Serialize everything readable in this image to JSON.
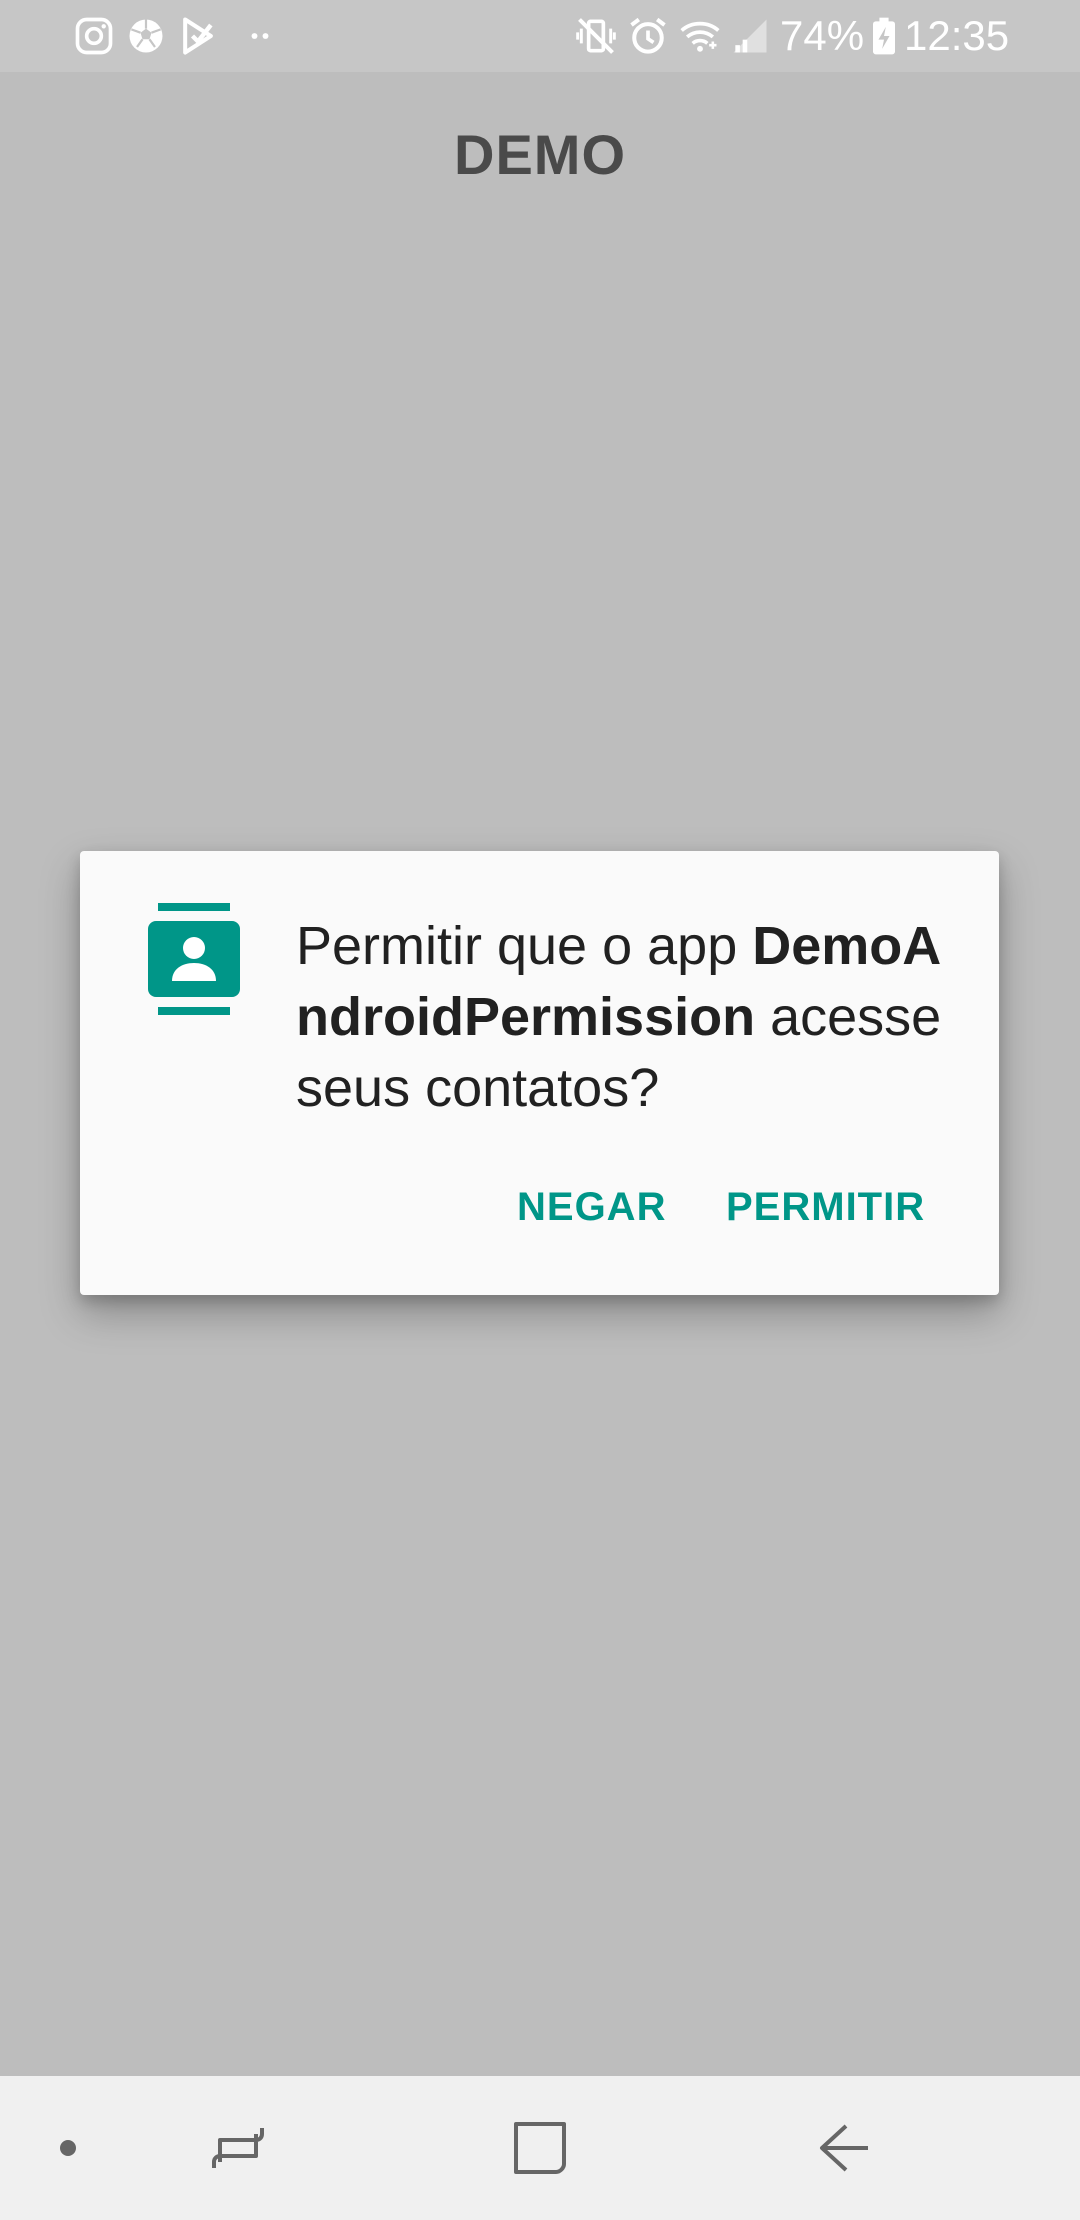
{
  "status_bar": {
    "icons": [
      "instagram-icon",
      "soccer-ball-icon",
      "play-store-icon",
      "more-notifications-icon",
      "vibrate-mute-icon",
      "alarm-icon",
      "wifi-icon",
      "signal-icon",
      "battery-charging-icon"
    ],
    "battery": "74%",
    "time": "12:35"
  },
  "app": {
    "title": "DEMO"
  },
  "dialog": {
    "icon": "contacts-icon",
    "message_prefix": "Permitir que o app ",
    "app_name": "DemoAndroidPermission",
    "message_suffix": " acesse seus contatos?",
    "deny_label": "NEGAR",
    "allow_label": "PERMITIR"
  },
  "nav_bar": {
    "icons": [
      "dot-indicator-icon",
      "recent-apps-icon",
      "home-icon",
      "back-icon"
    ]
  },
  "colors": {
    "accent": "#009688",
    "scrim": "#bdbdbd",
    "dialog_bg": "#fafafa",
    "nav_bg": "#f0f0f0"
  }
}
